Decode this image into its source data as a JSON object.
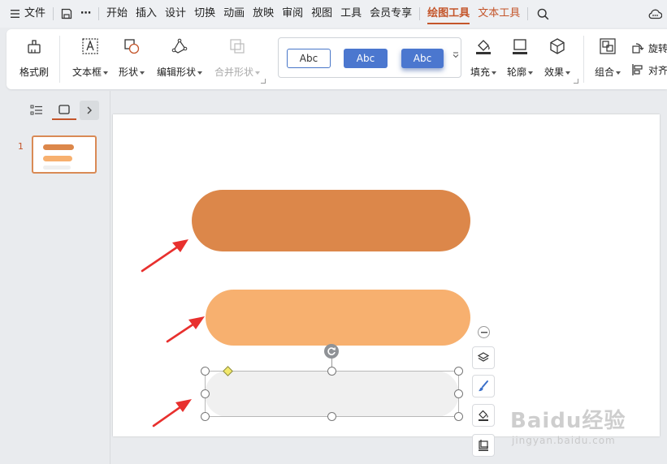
{
  "menu": {
    "file_label": "文件",
    "more_label": "⋯",
    "tabs": [
      "开始",
      "插入",
      "设计",
      "切换",
      "动画",
      "放映",
      "审阅",
      "视图",
      "工具",
      "会员专享"
    ],
    "draw_tool_label": "绘图工具",
    "text_tool_label": "文本工具"
  },
  "ribbon": {
    "format_brush": "格式刷",
    "textbox": "文本框",
    "shape": "形状",
    "edit_shape": "编辑形状",
    "merge_shape": "合并形状",
    "style_samples": [
      "Abc",
      "Abc",
      "Abc"
    ],
    "fill": "填充",
    "outline": "轮廓",
    "effect": "效果",
    "group": "组合",
    "rotate": "旋转",
    "align": "对齐"
  },
  "slides": {
    "numbers": [
      "1"
    ]
  },
  "colors": {
    "accent": "#c4552a",
    "pill_dark": "#dc874a",
    "pill_light": "#f7b06f",
    "pill_gray": "#f0f0f0",
    "arrow_red": "#e8302e",
    "style_blue": "#4b77cf"
  },
  "icons": {
    "menu": "hamburger-icon",
    "save": "save-icon",
    "search": "search-icon",
    "cloud": "cloud-icon",
    "layers": "layers-icon",
    "brush": "brush-icon",
    "fill": "fill-bucket-icon",
    "crop": "crop-icon"
  },
  "watermark": {
    "main": "Baidu经验",
    "sub": "jingyan.baidu.com"
  }
}
